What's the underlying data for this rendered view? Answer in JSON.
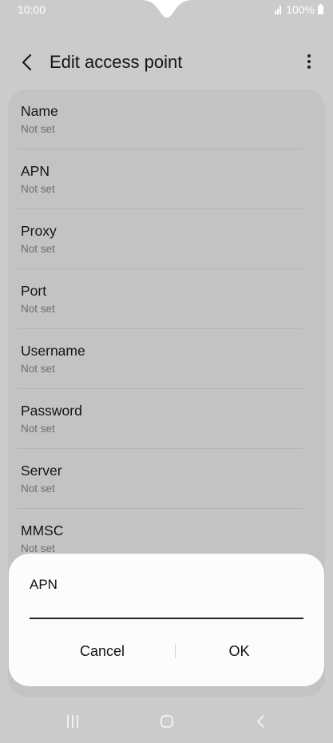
{
  "status_bar": {
    "time": "10:00",
    "battery_text": "100%"
  },
  "header": {
    "title": "Edit access point"
  },
  "settings": [
    {
      "label": "Name",
      "value": "Not set"
    },
    {
      "label": "APN",
      "value": "Not set"
    },
    {
      "label": "Proxy",
      "value": "Not set"
    },
    {
      "label": "Port",
      "value": "Not set"
    },
    {
      "label": "Username",
      "value": "Not set"
    },
    {
      "label": "Password",
      "value": "Not set"
    },
    {
      "label": "Server",
      "value": "Not set"
    },
    {
      "label": "MMSC",
      "value": "Not set"
    }
  ],
  "dialog": {
    "title": "APN",
    "input_value": "",
    "cancel_label": "Cancel",
    "ok_label": "OK"
  },
  "icons": {
    "back": "back-arrow-icon",
    "more": "more-options-icon",
    "signal": "signal-icon",
    "battery": "battery-icon",
    "nav_recents": "recents-icon",
    "nav_home": "home-icon",
    "nav_back": "back-icon"
  }
}
